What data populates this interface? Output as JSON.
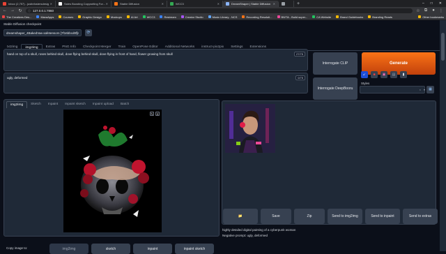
{
  "browser": {
    "tabs": [
      {
        "title": "Inbox (2,757) - justinfostersdesig",
        "favicon_color": "#ea4335",
        "active": false
      },
      {
        "title": "Sales Boosting Copywriting For...",
        "favicon_color": "#ffffff",
        "active": false
      },
      {
        "title": "Stable Diffusion",
        "favicon_color": "#f97316",
        "active": false
      },
      {
        "title": "WCC3",
        "favicon_color": "#34a853",
        "active": false
      },
      {
        "title": "DreamShaper | Stable Diffusion",
        "favicon_color": "#8ab4f8",
        "active": true
      },
      {
        "title": "",
        "favicon_color": "#9aa0a6",
        "active": false
      }
    ],
    "new_tab": "+",
    "window_controls": {
      "minimize": "–",
      "maximize": "□",
      "close": "✕"
    },
    "url": "127.0.0.1:7860",
    "bookmarks": [
      "The Creatives Des...",
      "MavaApps",
      "Courses",
      "Graphic Design",
      "Mockups",
      "AI Art",
      "WCC3",
      "Restream",
      "Creator Studio",
      "Music Library - NCS",
      "Recording Resoluti...",
      "BWTA - Build super...",
      "CA Website",
      "Brand Guidebooks",
      "Branding Reads"
    ],
    "other_bookmarks": "Other bookmarks"
  },
  "app": {
    "checkpoint_label": "Stable Diffusion checkpoint",
    "checkpoint_value": "dreamshaper_4BakedVae.safetensors [7f16bbcd0f]",
    "refresh_icon": "refresh-icon",
    "main_tabs": [
      "txt2img",
      "img2img",
      "Extras",
      "PNG Info",
      "Checkpoint Merger",
      "Train",
      "OpenPose Editor",
      "Additional Networks",
      "instruct-pix2pix",
      "Settings",
      "Extensions"
    ],
    "active_main_tab": "img2img",
    "prompt": {
      "text": "hand on top of a skull, roses behind skull, dove flying behind skull, dove flying in front of hand, flower growing from skull",
      "counter": "27/75"
    },
    "negative_prompt": {
      "text": "ugly, deformed",
      "counter": "0/75"
    },
    "interrogate_clip": "Interrogate CLIP",
    "interrogate_deepbooru": "Interrogate DeepBooru",
    "generate": "Generate",
    "generate_color": "#ea580c",
    "tool_icons": [
      "arrow-icon",
      "trash-icon",
      "image-icon",
      "save-icon",
      "clipboard-icon"
    ],
    "styles_label": "Styles",
    "styles_close": "×",
    "styles_chevron": "▾",
    "sub_tabs": [
      "img2img",
      "Sketch",
      "Inpaint",
      "Inpaint sketch",
      "Inpaint upload",
      "Batch"
    ],
    "active_sub_tab": "img2img",
    "canvas_controls": [
      "✎",
      "✕"
    ],
    "copy_image_to": "Copy image to:",
    "copy_buttons": [
      "img2img",
      "sketch",
      "inpaint",
      "inpaint sketch"
    ],
    "action_buttons": [
      {
        "label": "📁",
        "name": "open-folder-button"
      },
      {
        "label": "Save",
        "name": "save-button"
      },
      {
        "label": "Zip",
        "name": "zip-button"
      },
      {
        "label": "Send to img2img",
        "name": "send-to-img2img-button"
      },
      {
        "label": "Send to inpaint",
        "name": "send-to-inpaint-button"
      },
      {
        "label": "Send to extras",
        "name": "send-to-extras-button"
      }
    ],
    "output_info": "highly detailed digital painting of a cyberpunk woman",
    "output_negative": "Negative prompt: ugly, deformed"
  }
}
